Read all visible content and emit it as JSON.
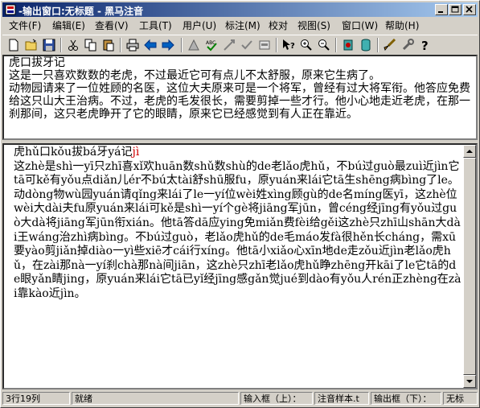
{
  "window": {
    "title": "-输出窗口:无标题 - 黑马注音",
    "controls": [
      "minimize-icon",
      "maximize-icon",
      "close-icon"
    ]
  },
  "menu": [
    "文件(F)",
    "编辑(E)",
    "查看(V)",
    "工具(T)",
    "用户(U)",
    "标注(M)",
    "校对",
    "视图(S)",
    "窗口(W)",
    "帮助(H)"
  ],
  "toolbar": {
    "tools": [
      "new-icon",
      "open-icon",
      "save-icon",
      "cut-icon",
      "copy-icon",
      "paste-icon",
      "print-icon",
      "back-arrow-icon",
      "forward-arrow-icon",
      "annotate-icon",
      "spellcheck-icon",
      "mark-icon",
      "check-icon",
      "box-icon",
      "help-cursor-icon",
      "zoom-in-icon",
      "zoom-out-icon",
      "recorder-icon",
      "database-icon",
      "brush-icon",
      "tools-icon",
      "question-icon"
    ]
  },
  "input_pane": {
    "text": "虎口拔牙记\n这是一只喜欢数数的老虎，不过最近它可有点儿不太舒服，原来它生病了。\n动物园请来了一位姓顾的名医，这位大夫原来可是一个将军，曾经有过大将军衔。他答应免费给这只山大王治病。不过，老虎的毛发很长，需要剪掉一些才行。他小心地走近老虎，在那一刹那间，这只老虎睁开了它的眼睛，原来它已经感觉到有人正在靠近。"
  },
  "output_pane": {
    "title_plain": "虎hǔ口kǒu拔bá牙yá记",
    "title_red": "jì",
    "body": "这zhè是shì一yī只zhī喜xǐ欢huān数shǔ数shù的de老lǎo虎hǔ，不bú过guò最zuì近jìn它tā可kě有yǒu点diǎn儿ér不bú太tài舒shū服fu，原yuán来lái它tā生shēng病bìng了le。动dòng物wù园yuán请qǐng来lái了le一yí位wèi姓xìng顾gù的de名míng医yī，这zhè位wèi大dài夫fu原yuán来lái可kě是shì一yí个gè将jiāng军jūn，曾céng经jīng有yǒu过guò大dà将jiāng军jūn衔xián。他tā答dā应ying免miǎn费fèi给gěi这zhè只zhī山shān大dài王wáng治zhì病bìng。不bú过guò，老lǎo虎hǔ的de毛máo发fà很hěn长cháng，需xū要yào剪jiǎn掉diào一yì些xiē才cái行xíng。他tā小xiǎo心xīn地de走zǒu近jìn老lǎo虎hǔ，在zài那nà一yí刹chà那nà间jiān，这zhè只zhī老lǎo虎hǔ睁zhēng开kāi了le它tā的de眼yǎn睛jing，原yuán来lái它tā已yǐ经jīng感gǎn觉jué到dào有yǒu人rén正zhèng在zài靠kào近jìn。"
  },
  "status": {
    "position": "3行19列",
    "state": "就绪",
    "input_frame_label": "输入框（上）：",
    "input_frame_value": "注音样本.t",
    "output_frame_label": "输出框（下）：",
    "output_frame_value": "无标"
  }
}
